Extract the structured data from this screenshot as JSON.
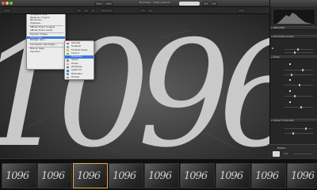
{
  "window": {
    "title": "FR-mtoke - milstr_pano.tif",
    "traffic_colors": [
      "#ee5c54",
      "#f4be4f",
      "#61c454"
    ]
  },
  "image_numerals": "1096",
  "context_menu": {
    "items": [
      {
        "label": "Ouvrir",
        "type": "item"
      },
      {
        "label": "Ouvrir depuis",
        "type": "item"
      },
      {
        "label": "",
        "type": "sep"
      },
      {
        "label": "Fermer",
        "type": "item"
      },
      {
        "label": "Enregistrer",
        "type": "item"
      },
      {
        "label": "Enregistrer sous...",
        "type": "item"
      },
      {
        "label": "Restaurer l'original",
        "type": "item"
      },
      {
        "label": "Renommer...",
        "type": "item"
      },
      {
        "label": "Dupliquer...",
        "type": "item"
      },
      {
        "label": "",
        "type": "sep"
      },
      {
        "label": "Afficher fichier d'origine",
        "type": "item"
      },
      {
        "label": "Afficher fichier ouvert",
        "type": "item"
      },
      {
        "label": "",
        "type": "sep"
      },
      {
        "label": "Exporter l'image...",
        "type": "item"
      },
      {
        "label": "Ouvrir avec",
        "type": "item",
        "highlight": true
      },
      {
        "label": "Partager dans...",
        "type": "item"
      },
      {
        "label": "",
        "type": "sep"
      },
      {
        "label": "Commander des tirages...",
        "type": "item"
      },
      {
        "label": "",
        "type": "sep"
      },
      {
        "label": "Mise en page...",
        "type": "item"
      },
      {
        "label": "Imprimer...",
        "type": "item"
      }
    ]
  },
  "submenu": {
    "items": [
      {
        "label": "Intensify",
        "icon_color": "#d9534f"
      },
      {
        "label": "Snapheal",
        "icon_color": "#5bc0de"
      },
      {
        "label": "FX Photo Studio",
        "icon_color": "#f0ad4e"
      },
      {
        "label": "Focus 2",
        "icon_color": "#5cb85c"
      },
      {
        "label": "Photoshop",
        "icon_color": "#2a6fd6",
        "highlight": true
      },
      {
        "label": "Aperçu",
        "icon_color": "#8e8e8e"
      },
      {
        "label": "Photos",
        "icon_color": "#e8a84a"
      },
      {
        "label": "Photoshop",
        "icon_color": "#2a6fd6"
      },
      {
        "label": "Lightroom",
        "icon_color": "#4a7fb0"
      },
      {
        "label": "Pixelmator",
        "icon_color": "#3aa0d8"
      },
      {
        "label": "Preview",
        "icon_color": "#8e8e8e"
      }
    ]
  },
  "inspector": {
    "sections": [
      {
        "label": "REGLAGES"
      },
      {
        "label": "Paramètres de base"
      },
      {
        "label": "Teinte"
      },
      {
        "label": "Courbes"
      },
      {
        "label": "Calque / Composite"
      }
    ]
  },
  "brush_panel": {
    "label": "PINCEAU",
    "size": "Taille"
  },
  "filmstrip": {
    "count": 9,
    "selected_index": 2
  }
}
